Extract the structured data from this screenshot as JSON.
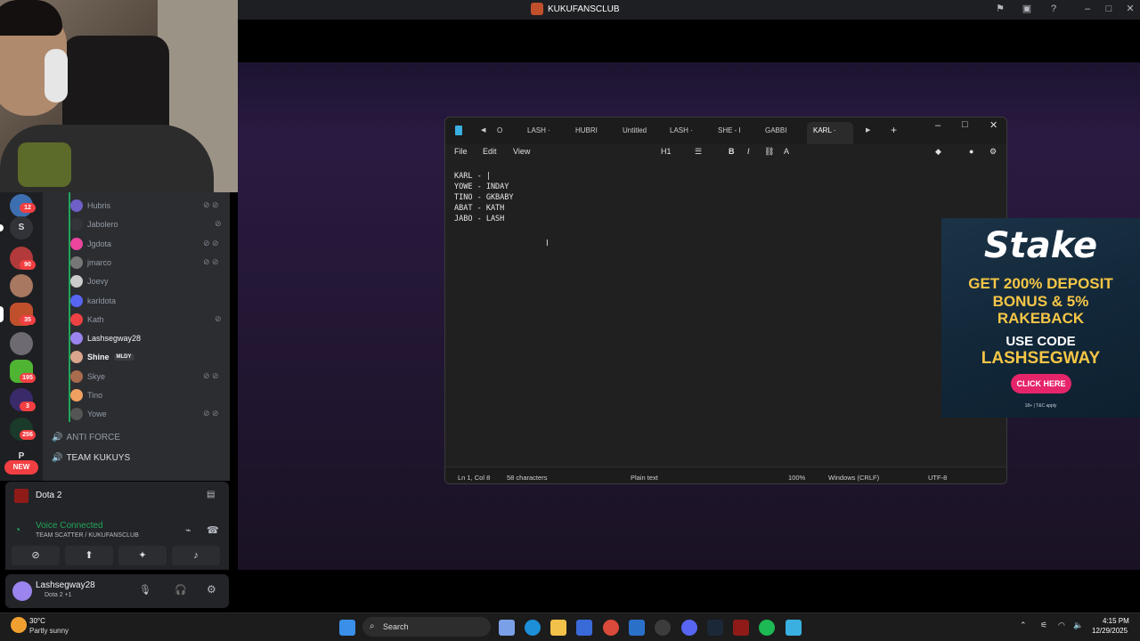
{
  "window": {
    "title": "KUKUFANSCLUB"
  },
  "rail": {
    "badges": [
      "12",
      "90",
      "35",
      "195",
      "3",
      "256"
    ],
    "letters": [
      "S",
      "P"
    ],
    "new_label": "NEW"
  },
  "members": [
    {
      "name": "Hubris",
      "color": "#6e5fc6",
      "icons": "deafened"
    },
    {
      "name": "Jabolero",
      "color": "#34353b",
      "icons": "muted"
    },
    {
      "name": "Jgdota",
      "color": "#eb459e",
      "icons": "deafened"
    },
    {
      "name": "jmarco",
      "color": "#777",
      "icons": "deafened"
    },
    {
      "name": "Joevy",
      "color": "#ccc",
      "icons": ""
    },
    {
      "name": "karldota",
      "color": "#5865f2",
      "icons": ""
    },
    {
      "name": "Kath",
      "color": "#ed4245",
      "icons": "muted"
    },
    {
      "name": "Lashsegway28",
      "color": "#9b84ee",
      "icons": ""
    },
    {
      "name": "Shine",
      "color": "#d9a48a",
      "icons": "",
      "tag": "MLDY"
    },
    {
      "name": "Skye",
      "color": "#a86b4d",
      "icons": "deafened"
    },
    {
      "name": "Tino",
      "color": "#f0a060",
      "icons": ""
    },
    {
      "name": "Yowe",
      "color": "#555",
      "icons": "deafened"
    }
  ],
  "voice_channels": [
    "ANTI FORCE",
    "TEAM KUKUYS"
  ],
  "activity": {
    "game": "Dota 2"
  },
  "voice": {
    "status": "Voice Connected",
    "channel": "TEAM SCATTER / KUKUFANSCLUB"
  },
  "user": {
    "name": "Lashsegway28",
    "status": "Dota 2 +1"
  },
  "notepad": {
    "tabs": [
      "O",
      "LASH ·",
      "HUBRI",
      "Untitled",
      "LASH ·",
      "SHE - I",
      "GABBI",
      "KARL ·"
    ],
    "menu": [
      "File",
      "Edit",
      "View"
    ],
    "heading": "H1",
    "lines": [
      "KARL - |",
      "YOWE - INDAY",
      "TINO - GKBABY",
      "ABAT - KATH",
      "JABO - LASH"
    ],
    "status": {
      "position": "Ln 1, Col 8",
      "chars": "58 characters",
      "type": "Plain text",
      "zoom": "100%",
      "eol": "Windows (CRLF)",
      "encoding": "UTF-8"
    }
  },
  "ad": {
    "brand": "Stake",
    "line1": "GET 200% DEPOSIT",
    "line2": "BONUS & 5%",
    "line3": "RAKEBACK",
    "line4": "USE CODE",
    "code": "LASHSEGWAY",
    "cta": "CLICK HERE",
    "fine": "18+ | T&C apply"
  },
  "taskbar": {
    "temp": "30°C",
    "weather": "Partly sunny",
    "search": "Search",
    "time": "4:15 PM",
    "date": "12/29/2025"
  }
}
